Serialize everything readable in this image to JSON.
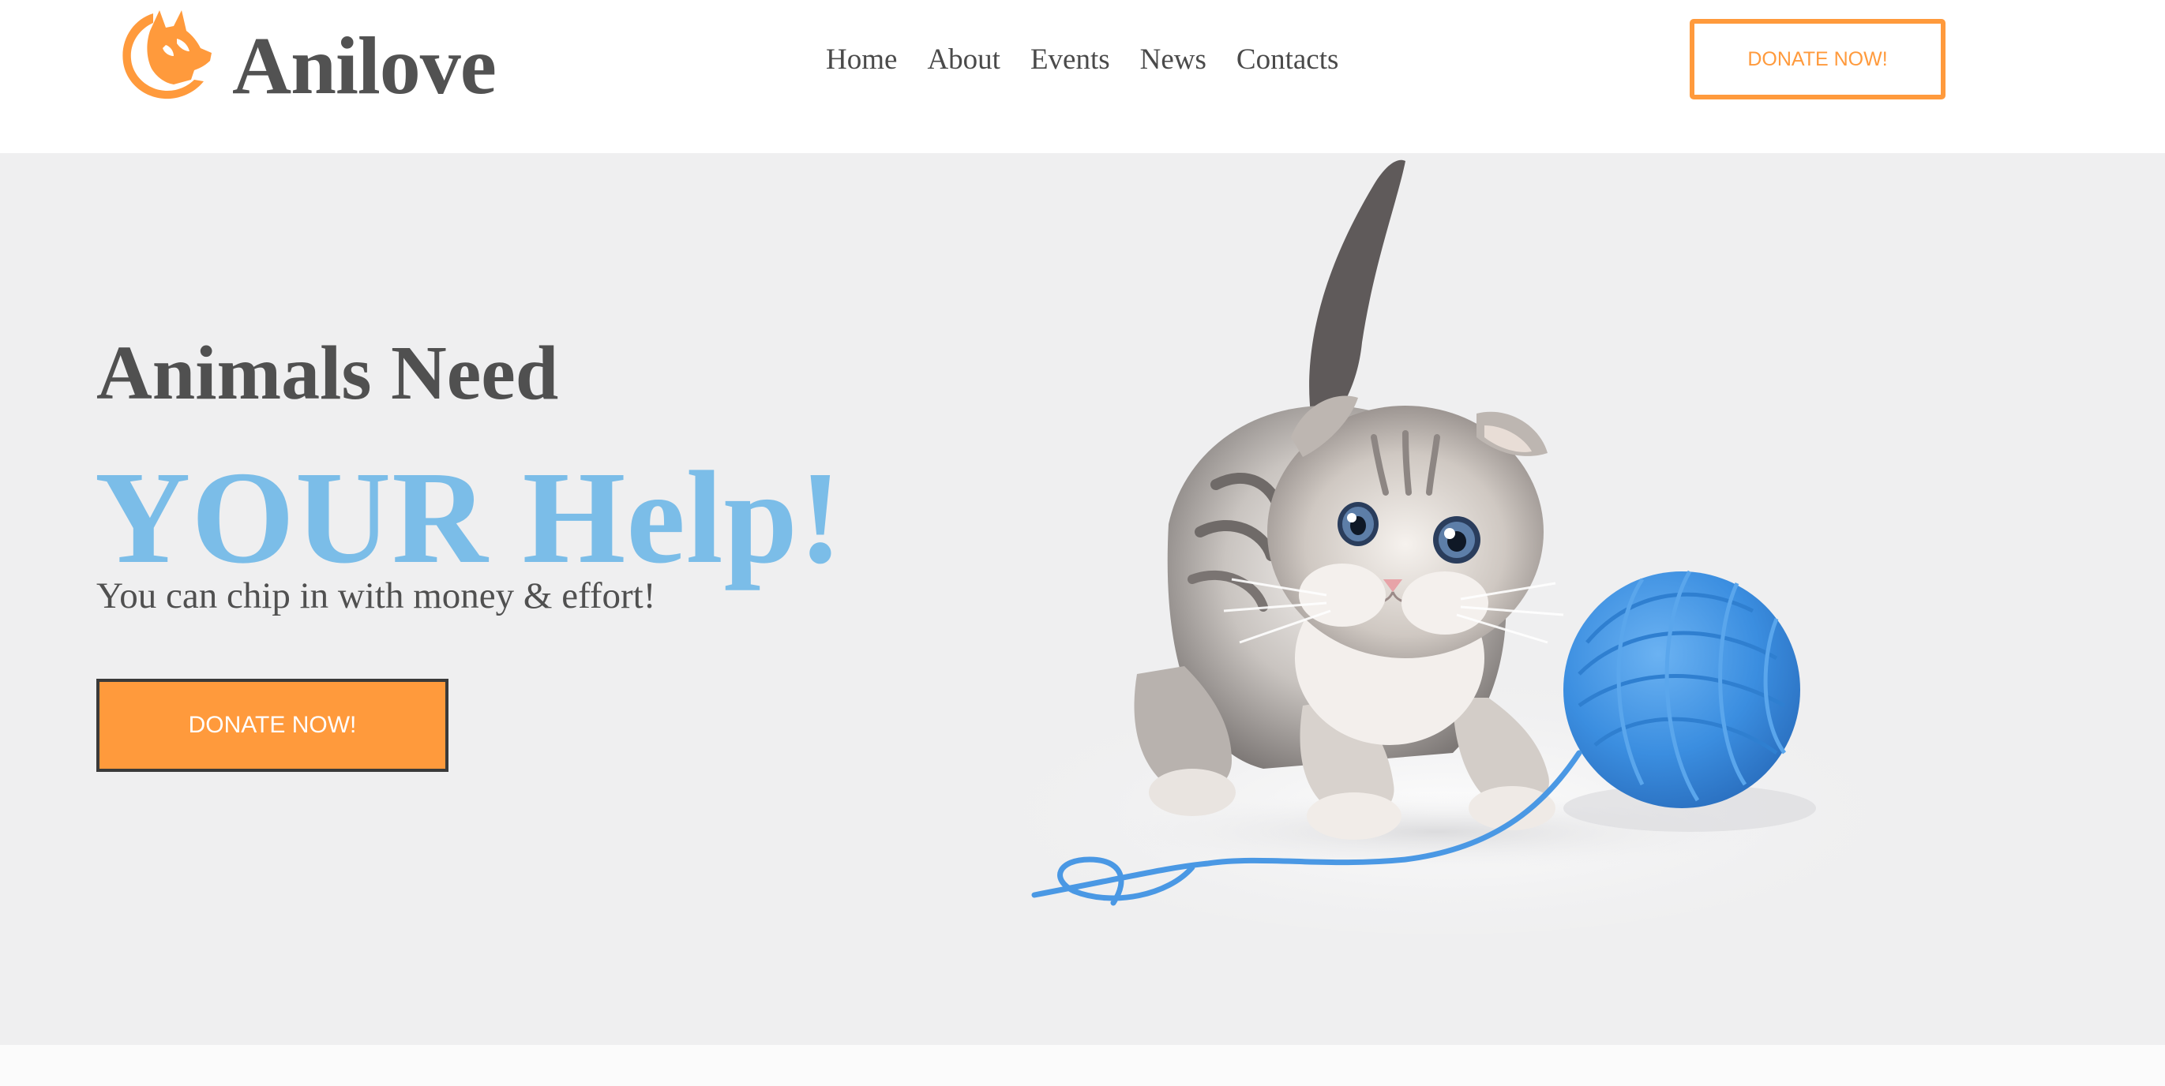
{
  "brand": {
    "name": "Anilove",
    "icon": "cat-dog-logo-icon",
    "accent_color": "#ff9a3c"
  },
  "nav": {
    "items": [
      {
        "label": "Home"
      },
      {
        "label": "About"
      },
      {
        "label": "Events"
      },
      {
        "label": "News"
      },
      {
        "label": "Contacts"
      }
    ]
  },
  "header": {
    "donate_label": "DONATE NOW!"
  },
  "hero": {
    "title": "Animals Need",
    "headline": "YOUR Help!",
    "subtitle": "You can chip in with money & effort!",
    "donate_label": "DONATE NOW!",
    "headline_color": "#7bbde8",
    "background_color": "#efeff0",
    "image": "kitten-with-yarn-image"
  }
}
